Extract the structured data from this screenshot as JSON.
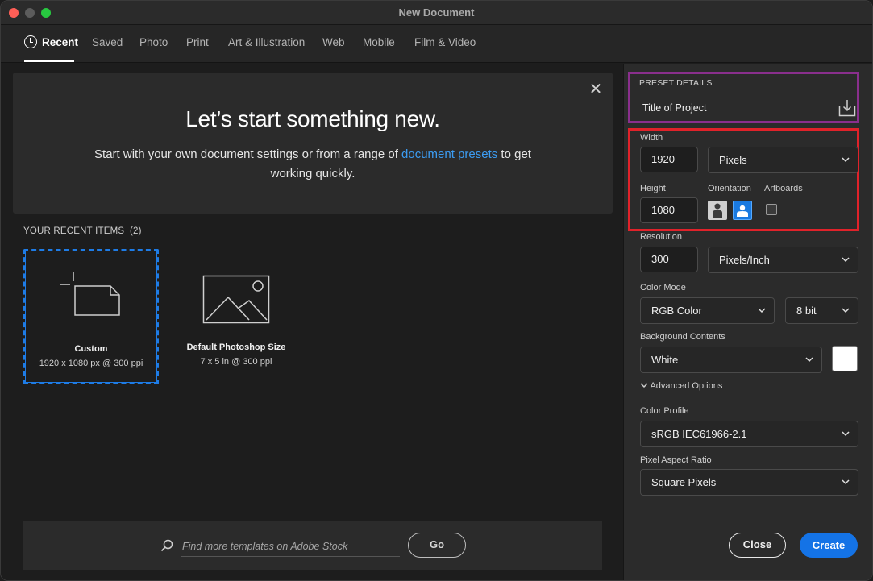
{
  "window": {
    "title": "New Document"
  },
  "tabs": [
    {
      "label": "Recent",
      "icon": "clock-icon",
      "active": true
    },
    {
      "label": "Saved"
    },
    {
      "label": "Photo"
    },
    {
      "label": "Print"
    },
    {
      "label": "Art & Illustration"
    },
    {
      "label": "Web"
    },
    {
      "label": "Mobile"
    },
    {
      "label": "Film & Video"
    }
  ],
  "hero": {
    "title": "Let’s start something new.",
    "subtitle_before": "Start with your own document settings or from a range of ",
    "subtitle_link": "document presets",
    "subtitle_after": " to get working quickly."
  },
  "recent": {
    "label": "YOUR RECENT ITEMS",
    "count": "(2)",
    "items": [
      {
        "name": "Custom",
        "detail": "1920 x 1080 px @ 300 ppi",
        "selected": true,
        "icon": "blank-document-icon"
      },
      {
        "name": "Default Photoshop Size",
        "detail": "7 x 5 in @ 300 ppi",
        "icon": "image-icon"
      }
    ]
  },
  "search": {
    "placeholder": "Find more templates on Adobe Stock",
    "go_label": "Go"
  },
  "preset": {
    "section_label": "PRESET DETAILS",
    "title": "Title of Project",
    "save_icon": "save-preset-icon"
  },
  "settings": {
    "width_label": "Width",
    "width_value": "1920",
    "width_unit": "Pixels",
    "height_label": "Height",
    "height_value": "1080",
    "orientation_label": "Orientation",
    "artboards_label": "Artboards",
    "orientation": "landscape",
    "artboards_checked": false,
    "resolution_label": "Resolution",
    "resolution_value": "300",
    "resolution_unit": "Pixels/Inch",
    "color_mode_label": "Color Mode",
    "color_mode": "RGB Color",
    "bit_depth": "8 bit",
    "background_label": "Background Contents",
    "background": "White",
    "background_swatch": "#ffffff",
    "advanced_label": "Advanced Options",
    "color_profile_label": "Color Profile",
    "color_profile": "sRGB IEC61966-2.1",
    "pixel_aspect_label": "Pixel Aspect Ratio",
    "pixel_aspect": "Square Pixels"
  },
  "actions": {
    "close_label": "Close",
    "create_label": "Create"
  },
  "colors": {
    "accent": "#1473e6",
    "link": "#3c9cf2",
    "highlight_purple": "#8a2f8d",
    "highlight_red": "#e0222a"
  }
}
